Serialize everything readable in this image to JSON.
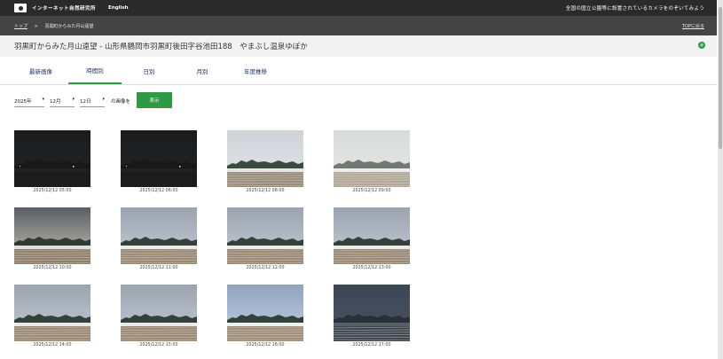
{
  "topbar": {
    "brand": "インターネット自然研究所",
    "en_label": "English",
    "tagline": "全国の国立公園等に設置されているカメラをのぞいてみよう"
  },
  "breadcrumb": {
    "home": "トップ",
    "separator": ">",
    "current": "羽黒町からみた月山遠望",
    "top_link": "TOPに戻る"
  },
  "page": {
    "title": "羽黒町からみた月山遠望 - 山形県鶴岡市羽黒町後田字谷池田188　やまぶし温泉ゆぽか"
  },
  "tabs": [
    {
      "label": "最新画像",
      "active": false
    },
    {
      "label": "時間別",
      "active": true
    },
    {
      "label": "日別",
      "active": false
    },
    {
      "label": "月別",
      "active": false
    },
    {
      "label": "年度推移",
      "active": false
    }
  ],
  "controls": {
    "year": "2025年",
    "month": "12月",
    "day": "12日",
    "suffix": "の画像を",
    "show_button": "表示"
  },
  "images": [
    {
      "caption": "2025/12/12 05:00",
      "scene": "night"
    },
    {
      "caption": "2025/12/12 06:00",
      "scene": "night"
    },
    {
      "caption": "2025/12/12 08:00",
      "scene": "dawn"
    },
    {
      "caption": "2025/12/12 09:00",
      "scene": "haze"
    },
    {
      "caption": "2025/12/12 10:00",
      "scene": "dramatic"
    },
    {
      "caption": "2025/12/12 11:00",
      "scene": "day"
    },
    {
      "caption": "2025/12/12 12:00",
      "scene": "day"
    },
    {
      "caption": "2025/12/12 13:00",
      "scene": "day"
    },
    {
      "caption": "2025/12/12 14:00",
      "scene": "day"
    },
    {
      "caption": "2025/12/12 15:00",
      "scene": "day"
    },
    {
      "caption": "2025/12/12 16:00",
      "scene": "blue"
    },
    {
      "caption": "2025/12/12 17:00",
      "scene": "dusk"
    }
  ],
  "colors": {
    "accent": "#2e9a46",
    "topbar": "#2a2a2a",
    "breadbar": "#444444"
  }
}
